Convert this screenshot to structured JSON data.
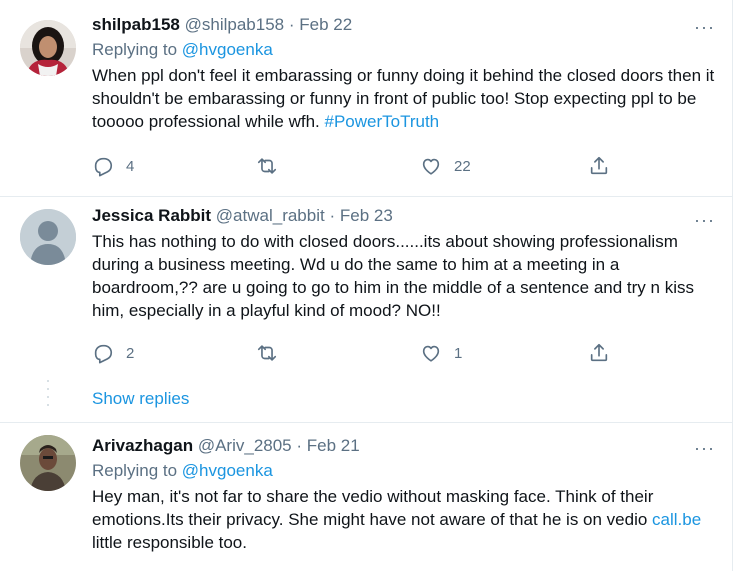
{
  "tweets": [
    {
      "name": "shilpab158",
      "handle": "@shilpab158",
      "separator": "·",
      "date": "Feb 22",
      "replying_prefix": "Replying to",
      "replying_to": "@hvgoenka",
      "text": "When ppl don't feel it embarassing or funny doing it behind the closed doors then it shouldn't be embarassing or funny in front of public too! Stop expecting ppl to be tooooo professional while wfh.",
      "hashtag": "#PowerToTruth",
      "more": "···",
      "replies": "4",
      "retweets": "",
      "likes": "22"
    },
    {
      "name": "Jessica Rabbit",
      "handle": "@atwal_rabbit",
      "separator": "·",
      "date": "Feb 23",
      "text": "This has nothing to do with closed doors......its about showing professionalism during a business meeting.  Wd u do the same to him at a meeting in a boardroom,?? are u going to go to him in the middle of a sentence and try n kiss him, especially in a playful kind of mood?  NO!!",
      "more": "···",
      "replies": "2",
      "retweets": "",
      "likes": "1"
    },
    {
      "name": "Arivazhagan",
      "handle": "@Ariv_2805",
      "separator": "·",
      "date": "Feb 21",
      "replying_prefix": "Replying to",
      "replying_to": "@hvgoenka",
      "text_before_link": "Hey man, it's not far to share the vedio without masking face. Think of their emotions.Its their privacy. She might have not aware of that he is on vedio ",
      "link": "call.be",
      "text_after_link": " little responsible too.",
      "more": "···"
    }
  ],
  "show_replies": "Show replies",
  "icons": [
    "reply-icon",
    "retweet-icon",
    "like-icon",
    "share-icon",
    "more-icon",
    "default-avatar-icon"
  ],
  "colors": {
    "link": "#1b95e0",
    "secondary_text": "#5b7083",
    "divider": "#e6ecf0",
    "default_avatar_bg": "#c4cfd6"
  }
}
